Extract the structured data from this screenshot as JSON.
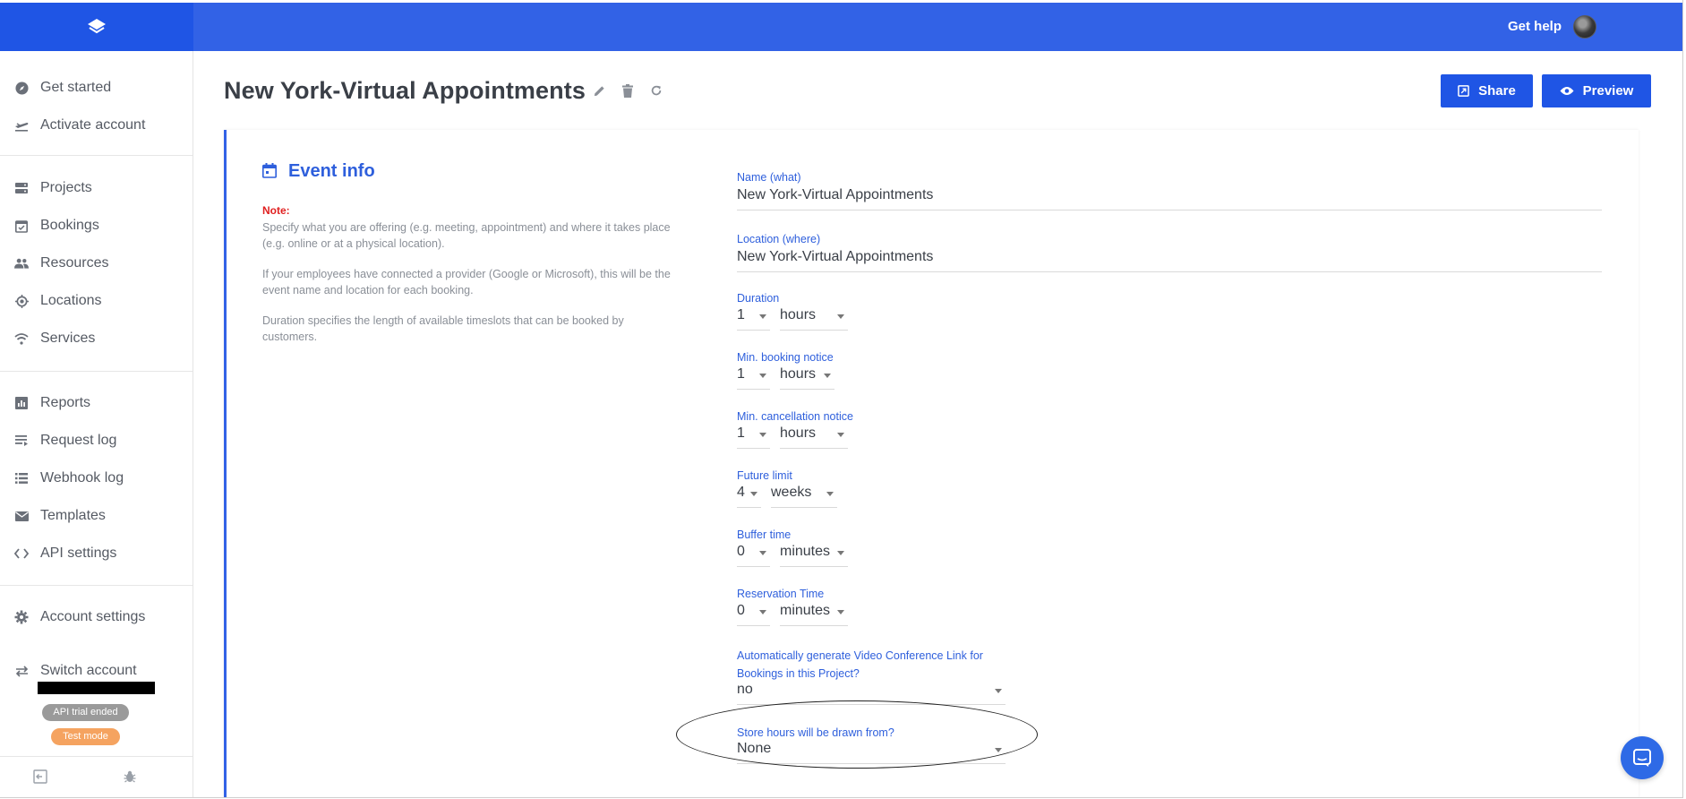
{
  "topbar": {
    "get_help": "Get help"
  },
  "sidebar": {
    "items": [
      {
        "label": "Get started",
        "icon": "compass-icon"
      },
      {
        "label": "Activate account",
        "icon": "plane-icon"
      },
      {
        "label": "Projects",
        "icon": "server-icon"
      },
      {
        "label": "Bookings",
        "icon": "calendar-check-icon"
      },
      {
        "label": "Resources",
        "icon": "people-icon"
      },
      {
        "label": "Locations",
        "icon": "location-target-icon"
      },
      {
        "label": "Services",
        "icon": "wifi-icon"
      },
      {
        "label": "Reports",
        "icon": "bar-chart-icon"
      },
      {
        "label": "Request log",
        "icon": "list-lines-icon"
      },
      {
        "label": "Webhook log",
        "icon": "list-bullets-icon"
      },
      {
        "label": "Templates",
        "icon": "envelope-icon"
      },
      {
        "label": "API settings",
        "icon": "code-icon"
      },
      {
        "label": "Account settings",
        "icon": "gear-icon"
      },
      {
        "label": "Switch account",
        "icon": "swap-icon"
      }
    ],
    "badges": {
      "trial": "API trial ended",
      "test": "Test mode"
    }
  },
  "header": {
    "title": "New York-Virtual Appointments",
    "share_label": "Share",
    "preview_label": "Preview"
  },
  "event_info": {
    "title": "Event info",
    "note_label": "Note:",
    "notes": [
      "Specify what you are offering (e.g. meeting, appointment) and where it takes place (e.g. online or at a physical location).",
      "If your employees have connected a provider (Google or Microsoft), this will be the event name and location for each booking.",
      "Duration specifies the length of available timeslots that can be booked by customers."
    ]
  },
  "form": {
    "name": {
      "label": "Name (what)",
      "value": "New York-Virtual Appointments"
    },
    "location": {
      "label": "Location (where)",
      "value": "New York-Virtual Appointments"
    },
    "duration": {
      "label": "Duration",
      "amount": "1",
      "unit": "hours"
    },
    "min_booking": {
      "label": "Min. booking notice",
      "amount": "1",
      "unit": "hours"
    },
    "min_cancellation": {
      "label": "Min. cancellation notice",
      "amount": "1",
      "unit": "hours"
    },
    "future_limit": {
      "label": "Future limit",
      "amount": "4",
      "unit": "weeks"
    },
    "buffer_time": {
      "label": "Buffer time",
      "amount": "0",
      "unit": "minutes"
    },
    "reservation_time": {
      "label": "Reservation Time",
      "amount": "0",
      "unit": "minutes"
    },
    "video_link": {
      "label": "Automatically generate Video Conference Link for Bookings in this Project?",
      "value": "no"
    },
    "store_hours": {
      "label": "Store hours will be drawn from?",
      "value": "None"
    }
  },
  "colors": {
    "brand": "#3262e6",
    "accent": "#1f55e5",
    "note_red": "#e02020",
    "test_badge": "#f5a360"
  }
}
